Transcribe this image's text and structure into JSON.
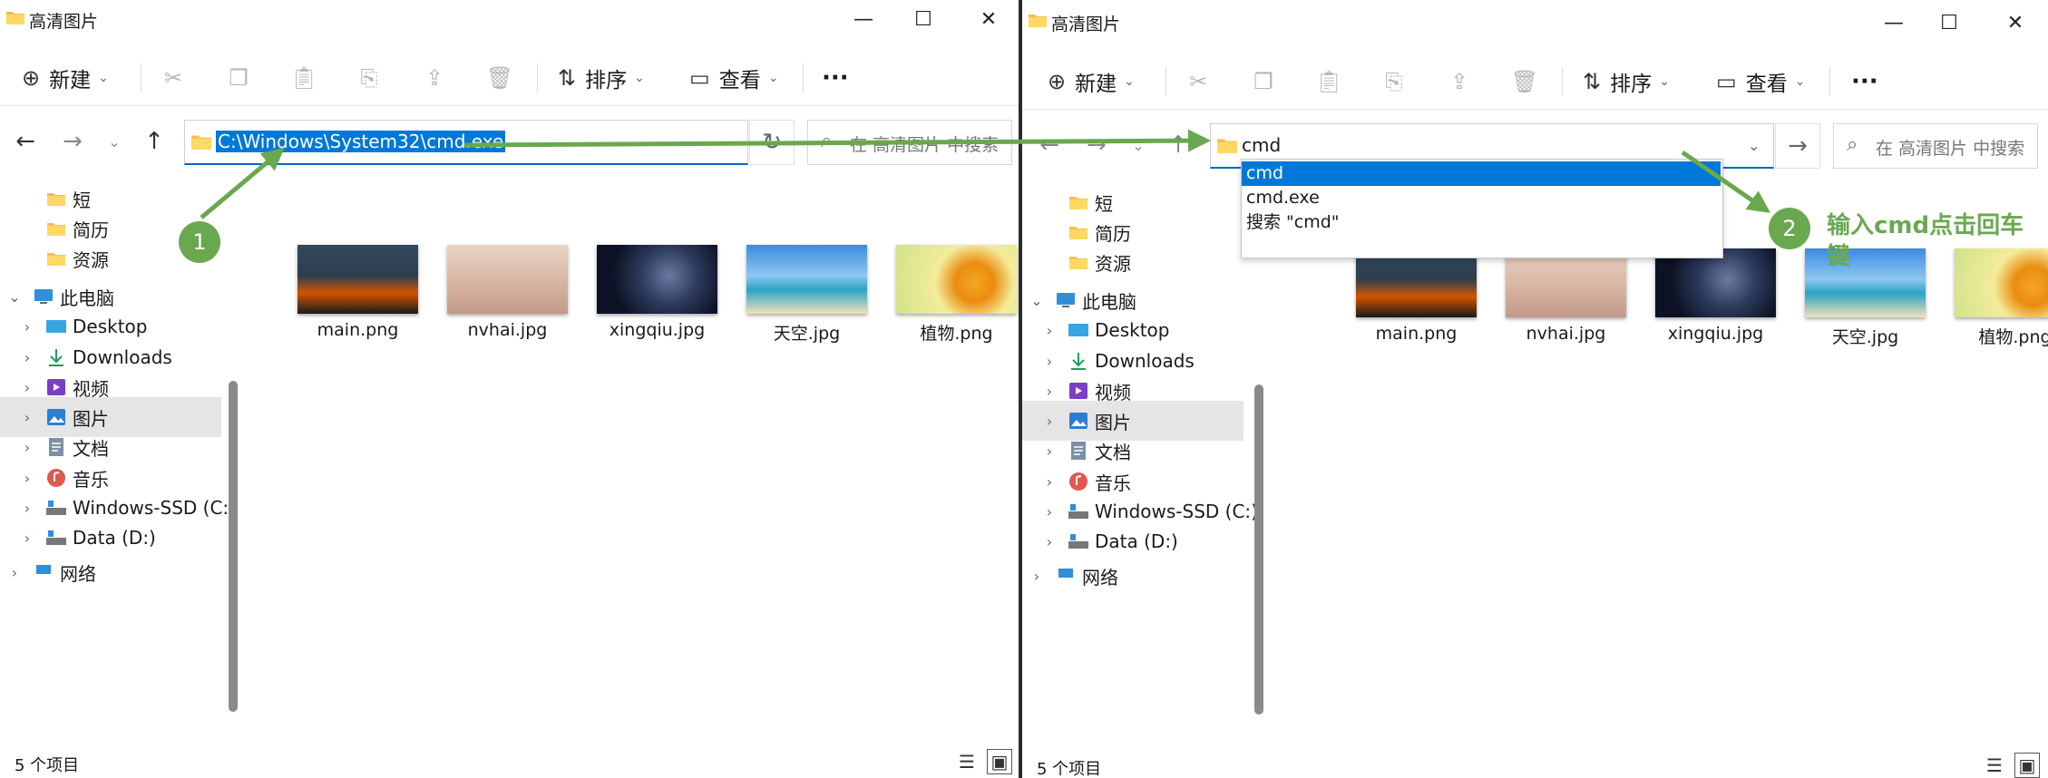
{
  "window_title": "高清图片",
  "window_controls": {
    "minimize": "—",
    "maximize": "☐",
    "close": "✕"
  },
  "toolbar": {
    "new_label": "新建",
    "sort_label": "排序",
    "view_label": "查看",
    "more_label": "···"
  },
  "left": {
    "address_value": "C:\\Windows\\System32\\cmd.exe",
    "search_placeholder": "在 高清图片 中搜索"
  },
  "right": {
    "address_value": "cmd",
    "search_placeholder": "在 高清图片 中搜索",
    "suggestions": [
      "cmd",
      "cmd.exe",
      "搜索 \"cmd\""
    ]
  },
  "sidebar": {
    "items": [
      {
        "label": "短",
        "icon": "folder-icon"
      },
      {
        "label": "简历",
        "icon": "folder-icon"
      },
      {
        "label": "资源",
        "icon": "folder-icon"
      },
      {
        "label": "此电脑",
        "icon": "computer-icon"
      },
      {
        "label": "Desktop",
        "icon": "desktop-icon"
      },
      {
        "label": "Downloads",
        "icon": "download-icon"
      },
      {
        "label": "视频",
        "icon": "video-icon"
      },
      {
        "label": "图片",
        "icon": "pictures-icon"
      },
      {
        "label": "文档",
        "icon": "document-icon"
      },
      {
        "label": "音乐",
        "icon": "music-icon"
      },
      {
        "label": "Windows-SSD (C:)",
        "icon": "drive-icon"
      },
      {
        "label": "Data (D:)",
        "icon": "drive-icon"
      },
      {
        "label": "网络",
        "icon": "network-icon"
      }
    ]
  },
  "files": [
    {
      "name": "main.png"
    },
    {
      "name": "nvhai.jpg"
    },
    {
      "name": "xingqiu.jpg"
    },
    {
      "name": "天空.jpg"
    },
    {
      "name": "植物.png"
    }
  ],
  "status": {
    "count_text": "5 个项目"
  },
  "annotations": {
    "step1": "1",
    "step2": "2",
    "step2_text": "输入cmd点击回车键"
  },
  "colors": {
    "accent": "#0078d7",
    "annotation": "#6aa84f",
    "folder": "#f4c04a"
  }
}
